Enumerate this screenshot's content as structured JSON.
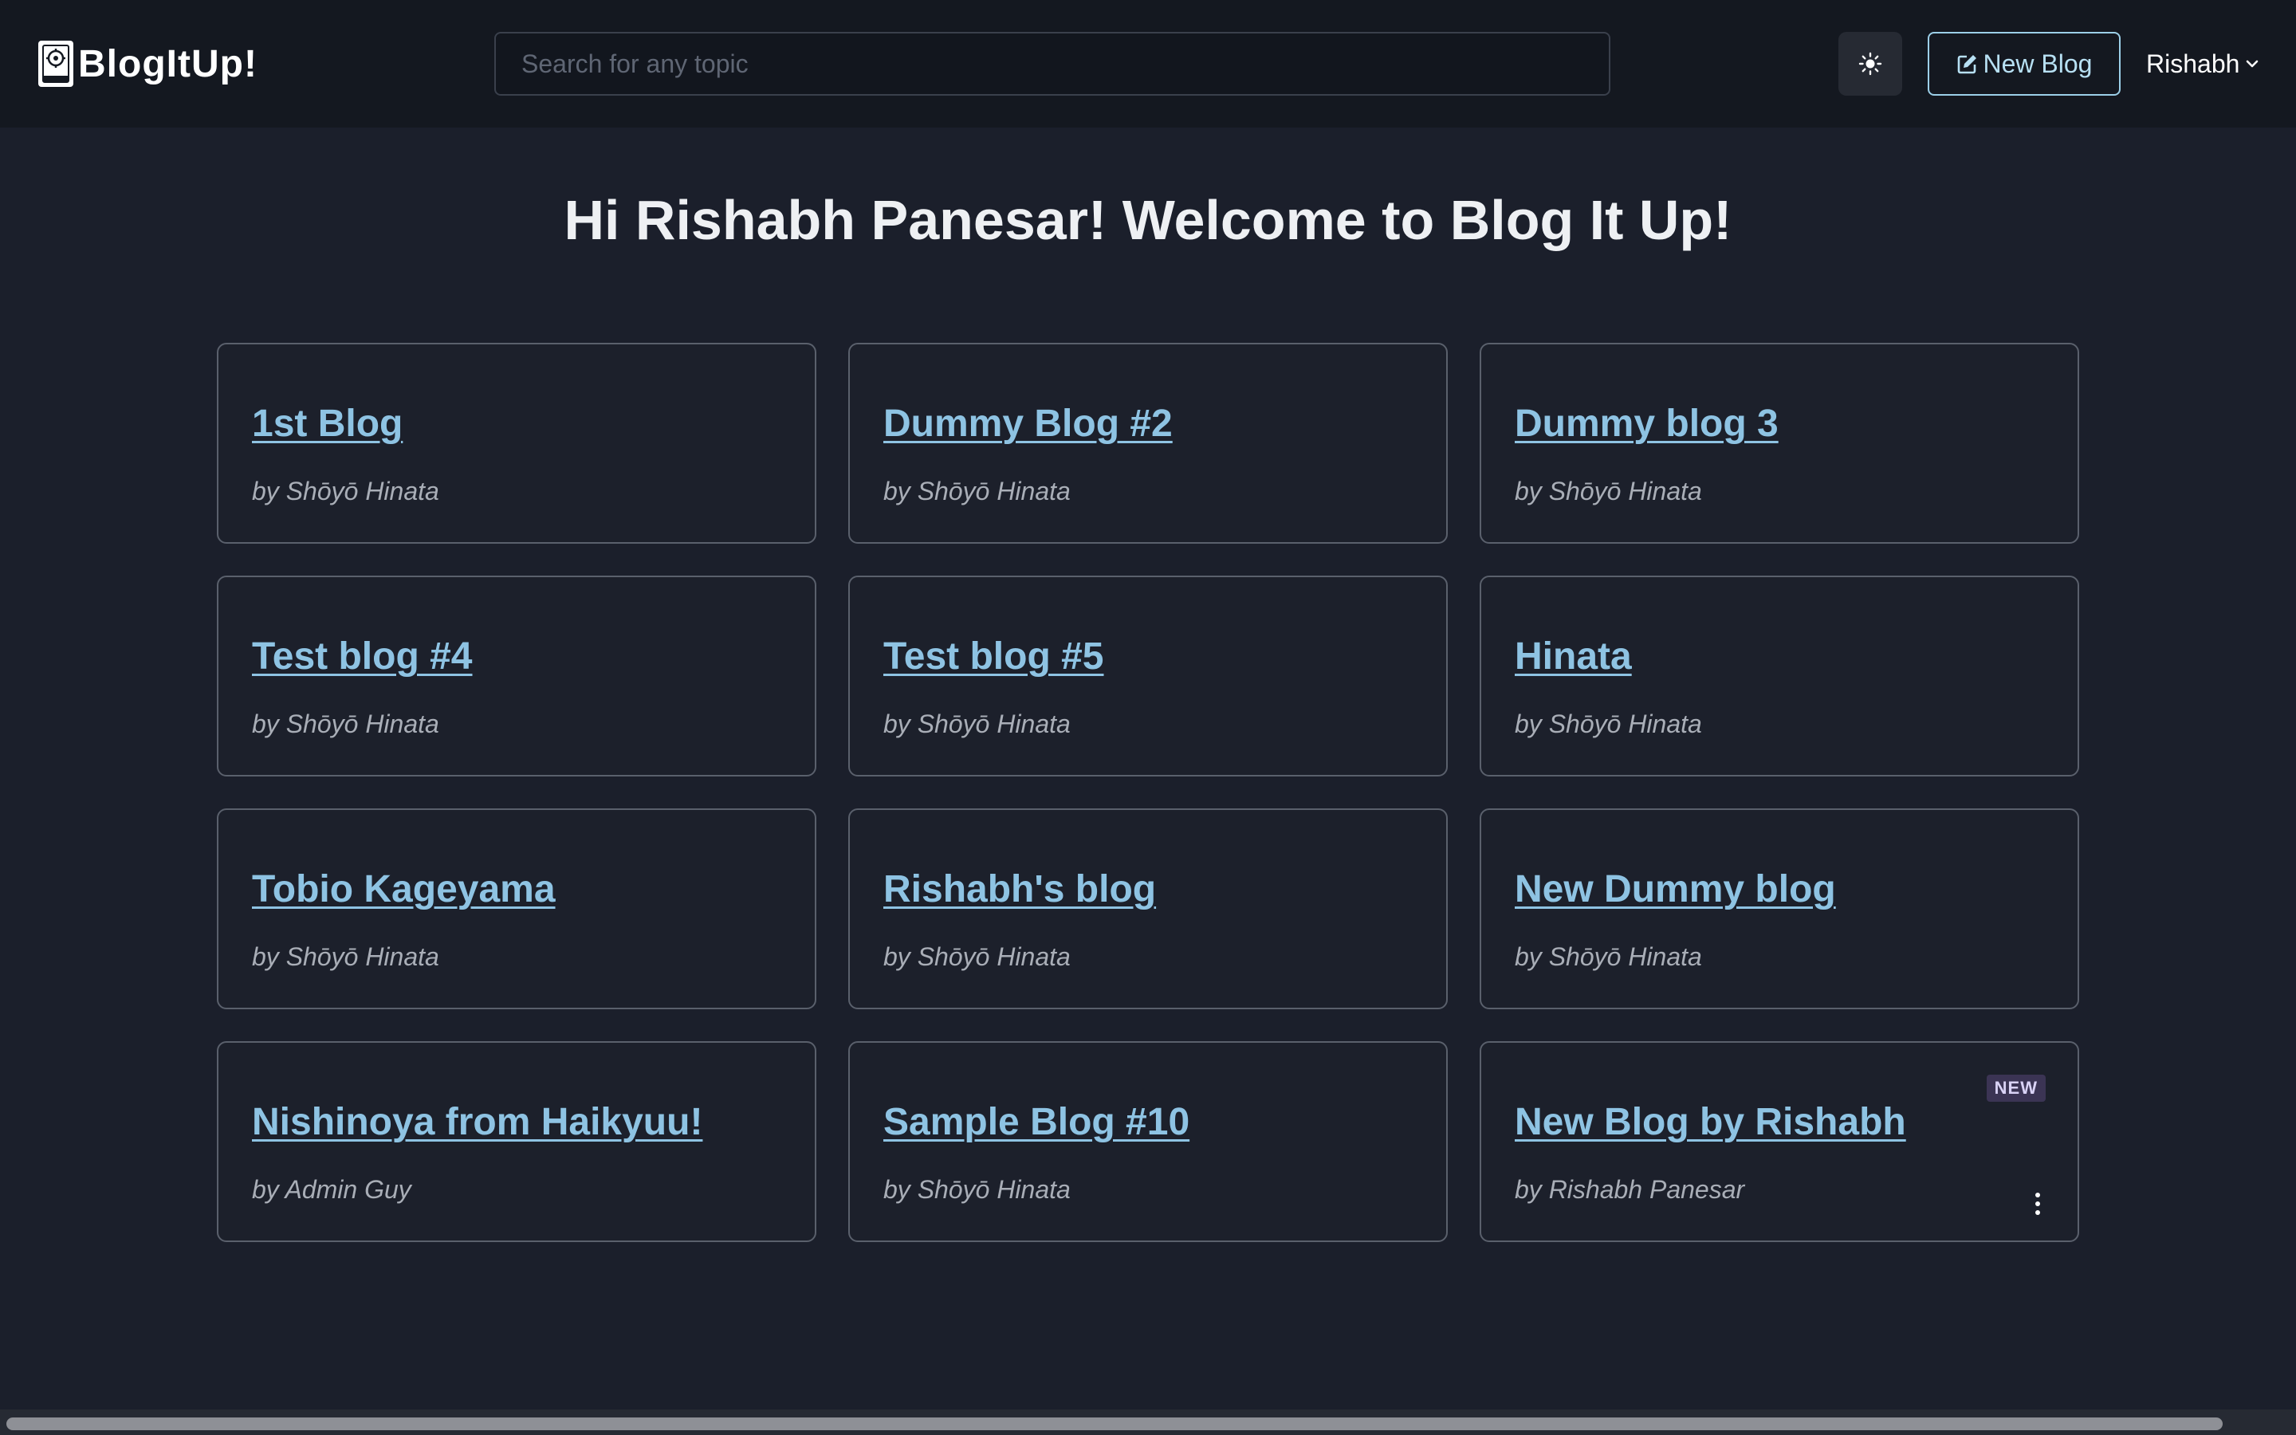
{
  "header": {
    "brand_name": "BlogItUp!",
    "search_placeholder": "Search for any topic",
    "theme_toggle_icon": "sun-icon",
    "new_blog_label": "New Blog",
    "new_blog_icon": "edit-icon",
    "user_name": "Rishabh"
  },
  "main": {
    "welcome": "Hi Rishabh Panesar! Welcome to Blog It Up!",
    "blogs": [
      {
        "title": "1st Blog",
        "author": "by Shōyō Hinata"
      },
      {
        "title": "Dummy Blog #2",
        "author": "by Shōyō Hinata"
      },
      {
        "title": "Dummy blog 3",
        "author": "by Shōyō Hinata"
      },
      {
        "title": "Test blog #4",
        "author": "by Shōyō Hinata"
      },
      {
        "title": "Test blog #5",
        "author": "by Shōyō Hinata"
      },
      {
        "title": "Hinata",
        "author": "by Shōyō Hinata"
      },
      {
        "title": "Tobio Kageyama",
        "author": "by Shōyō Hinata"
      },
      {
        "title": "Rishabh's blog",
        "author": "by Shōyō Hinata"
      },
      {
        "title": "New Dummy blog",
        "author": "by Shōyō Hinata"
      },
      {
        "title": "Nishinoya from Haikyuu!",
        "author": "by Admin Guy"
      },
      {
        "title": "Sample Blog #10",
        "author": "by Shōyō Hinata"
      },
      {
        "title": "New Blog by Rishabh",
        "author": "by Rishabh Panesar",
        "badge": "NEW",
        "has_menu": true
      }
    ]
  },
  "colors": {
    "background": "#1b1f2b",
    "header_bg": "#141820",
    "link": "#8ec3e3",
    "accent_outline": "#9ccfe8"
  }
}
